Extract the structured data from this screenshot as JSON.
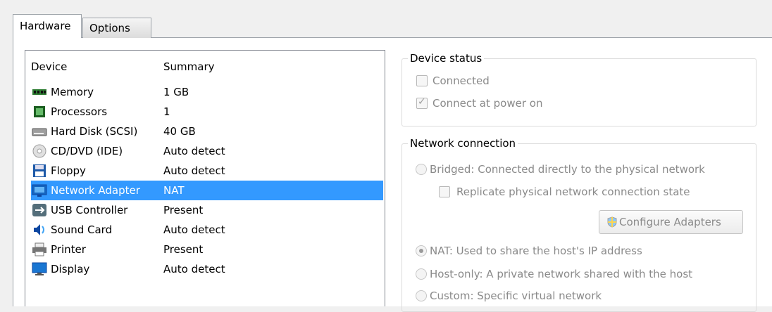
{
  "tabs": [
    {
      "label": "Hardware",
      "active": true
    },
    {
      "label": "Options",
      "active": false
    }
  ],
  "device_list": {
    "columns": [
      "Device",
      "Summary"
    ],
    "rows": [
      {
        "name": "Memory",
        "summary": "1 GB",
        "icon": "memory-icon"
      },
      {
        "name": "Processors",
        "summary": "1",
        "icon": "processor-icon"
      },
      {
        "name": "Hard Disk (SCSI)",
        "summary": "40 GB",
        "icon": "hard-disk-icon"
      },
      {
        "name": "CD/DVD (IDE)",
        "summary": "Auto detect",
        "icon": "cd-dvd-icon"
      },
      {
        "name": "Floppy",
        "summary": "Auto detect",
        "icon": "floppy-icon"
      },
      {
        "name": "Network Adapter",
        "summary": "NAT",
        "icon": "network-adapter-icon",
        "selected": true
      },
      {
        "name": "USB Controller",
        "summary": "Present",
        "icon": "usb-icon"
      },
      {
        "name": "Sound Card",
        "summary": "Auto detect",
        "icon": "sound-card-icon"
      },
      {
        "name": "Printer",
        "summary": "Present",
        "icon": "printer-icon"
      },
      {
        "name": "Display",
        "summary": "Auto detect",
        "icon": "display-icon"
      }
    ]
  },
  "device_status": {
    "title": "Device status",
    "connected": {
      "label": "Connected",
      "checked": false
    },
    "connect_at_power_on": {
      "label": "Connect at power on",
      "checked": true
    }
  },
  "network_connection": {
    "title": "Network connection",
    "bridged": {
      "label": "Bridged: Connected directly to the physical network",
      "selected": false
    },
    "replicate": {
      "label": "Replicate physical network connection state",
      "checked": false
    },
    "configure_button": "Configure Adapters",
    "nat": {
      "label": "NAT: Used to share the host's IP address",
      "selected": true
    },
    "host_only": {
      "label": "Host-only: A private network shared with the host",
      "selected": false
    },
    "custom": {
      "label": "Custom: Specific virtual network",
      "selected": false
    }
  },
  "colors": {
    "selection": "#3399ff",
    "disabled_text": "#8a8a8a"
  }
}
